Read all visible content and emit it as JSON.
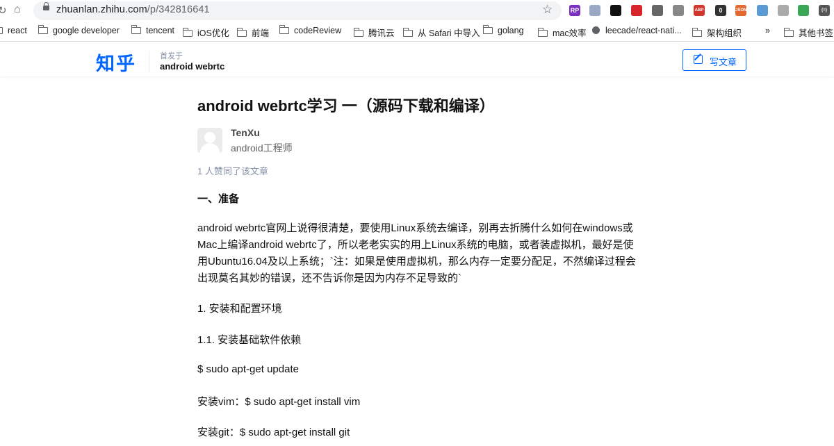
{
  "browser": {
    "url_host": "zhuanlan.zhihu.com",
    "url_path": "/p/342816641",
    "extensions": [
      {
        "icon": "rp-extension-icon",
        "text": "RP",
        "color": "#7b2fbe"
      },
      {
        "icon": "edge-extension-icon",
        "text": "",
        "color": "#9aa8c4"
      },
      {
        "icon": "octotree-extension-icon",
        "text": "",
        "color": "#111111"
      },
      {
        "icon": "pocket-extension-icon",
        "text": "",
        "color": "#d8242b"
      },
      {
        "icon": "gear-extension-icon",
        "text": "",
        "color": "#666666"
      },
      {
        "icon": "circle-extension-icon",
        "text": "",
        "color": "#888888"
      },
      {
        "icon": "adblock-extension-icon",
        "text": "ABP",
        "color": "#d2352b"
      },
      {
        "icon": "dark-extension-icon",
        "text": "0",
        "color": "#333333"
      },
      {
        "icon": "json-extension-icon",
        "text": "JSON",
        "color": "#e36a2e"
      },
      {
        "icon": "globe-extension-icon",
        "text": "",
        "color": "#5a9bd5"
      },
      {
        "icon": "search-extension-icon",
        "text": "",
        "color": "#aaaaaa"
      },
      {
        "icon": "chrome-extension-icon",
        "text": "",
        "color": "#3aa757"
      },
      {
        "icon": "braces-extension-icon",
        "text": "{=}",
        "color": "#555555"
      }
    ]
  },
  "bookmarks": [
    {
      "label": "react",
      "icon": "folder-icon"
    },
    {
      "label": "google developer",
      "icon": "folder-icon"
    },
    {
      "label": "tencent",
      "icon": "folder-icon"
    },
    {
      "label": "iOS优化",
      "icon": "folder-icon"
    },
    {
      "label": "前端",
      "icon": "folder-icon"
    },
    {
      "label": "codeReview",
      "icon": "folder-icon"
    },
    {
      "label": "腾讯云",
      "icon": "folder-icon"
    },
    {
      "label": "从 Safari 中导入",
      "icon": "folder-icon"
    },
    {
      "label": "golang",
      "icon": "folder-icon"
    },
    {
      "label": "mac效率",
      "icon": "folder-icon"
    },
    {
      "label": "leecade/react-nati...",
      "icon": "globe-icon"
    },
    {
      "label": "架构组织",
      "icon": "folder-icon"
    },
    {
      "label": "»",
      "icon": ""
    },
    {
      "label": "其他书签",
      "icon": "folder-icon"
    }
  ],
  "header": {
    "logo": "知乎",
    "published_in_label": "首发于",
    "column_name": "android webrtc",
    "write_button": "写文章"
  },
  "article": {
    "title": "android webrtc学习 一（源码下载和编译）",
    "author_name": "TenXu",
    "author_bio": "android工程师",
    "likes_text": "1 人赞同了该文章",
    "section_heading": "一、准备",
    "paragraph": "android webrtc官网上说得很清楚，要使用Linux系统去编译，别再去折腾什么如何在windows或Mac上编译android webrtc了，所以老老实实的用上Linux系统的电脑，或者装虚拟机，最好是使用Ubuntu16.04及以上系统；`注：如果是使用虚拟机，那么内存一定要分配足，不然编译过程会出现莫名其妙的错误，还不告诉你是因为内存不足导致的`",
    "lines": [
      "1. 安装和配置环境",
      "1.1. 安装基础软件依赖",
      "$ sudo apt-get update",
      "安装vim：$ sudo apt-get install vim",
      "安装git：$ sudo apt-get install git"
    ]
  }
}
